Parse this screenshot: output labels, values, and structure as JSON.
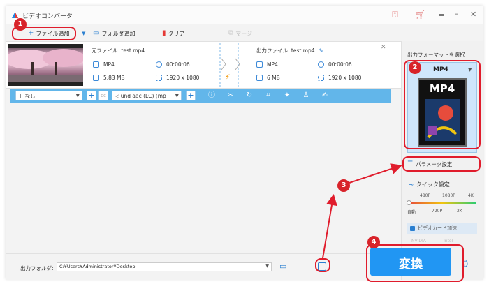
{
  "window": {
    "title": "ビデオコンバータ"
  },
  "toolbar": {
    "add_file": "ファイル追加",
    "add_folder": "フォルダ追加",
    "clear": "クリア",
    "merge": "マージ"
  },
  "file": {
    "source_label": "元ファイル: test.mp4",
    "source_format": "MP4",
    "source_duration": "00:00:06",
    "source_size": "5.83 MB",
    "source_resolution": "1920 x 1080",
    "output_label": "出力ファイル: test.mp4",
    "output_format": "MP4",
    "output_duration": "00:00:06",
    "output_size": "6 MB",
    "output_resolution": "1920 x 1080"
  },
  "editbar": {
    "subtitle": "なし",
    "audio": "und aac (LC) (mp"
  },
  "right_panel": {
    "title": "出力フォーマットを選択",
    "format": "MP4",
    "format_icon_text": "MP4",
    "parameter_settings": "パラメータ設定",
    "quick_settings": "クイック設定",
    "quality_top": [
      "480P",
      "1080P",
      "4K"
    ],
    "quality_bottom": [
      "自動",
      "720P",
      "2K"
    ],
    "gpu_accel": "ビデオカード加速",
    "gpu_brands": [
      "NVIDIA",
      "Intel"
    ]
  },
  "bottom": {
    "output_folder_label": "出力フォルダ:",
    "output_folder_path": "C:¥Users¥Administrator¥Desktop",
    "convert": "変換"
  },
  "annotations": {
    "step1": "1",
    "step2": "2",
    "step3": "3",
    "step4": "4"
  },
  "colors": {
    "accent_blue": "#2a9bf0",
    "edit_bar": "#62b6ea",
    "annotation_red": "#e01c2c",
    "convert_button": "#2196f3"
  },
  "icons": [
    "app-logo-icon",
    "key-icon",
    "cart-icon",
    "menu-icon",
    "minimize-icon",
    "close-icon",
    "plus-icon",
    "folder-icon",
    "trash-icon",
    "merge-icon",
    "edit-icon",
    "lightning-icon",
    "info-icon",
    "scissors-icon",
    "rotate-icon",
    "crop-icon",
    "effect-icon",
    "watermark-icon",
    "subtitle-icon",
    "alarm-icon"
  ]
}
